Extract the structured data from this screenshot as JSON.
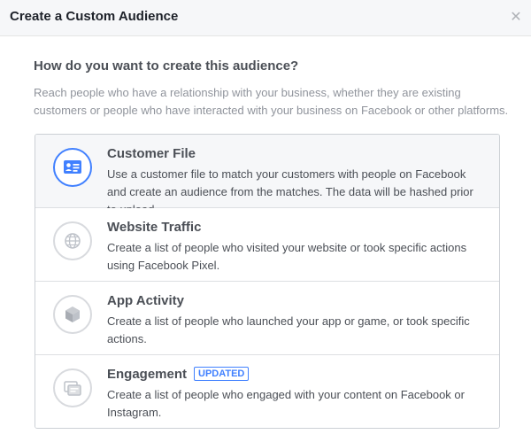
{
  "dialog": {
    "title": "Create a Custom Audience",
    "close_icon": "close-icon"
  },
  "question": "How do you want to create this audience?",
  "intro": "Reach people who have a relationship with your business, whether they are existing customers or people who have interacted with your business on Facebook or other platforms.",
  "options": [
    {
      "title": "Customer File",
      "description": "Use a customer file to match your customers with people on Facebook and create an audience from the matches. The data will be hashed prior to upload.",
      "icon": "contact-card-icon",
      "selected": true
    },
    {
      "title": "Website Traffic",
      "description": "Create a list of people who visited your website or took specific actions using Facebook Pixel.",
      "icon": "globe-icon",
      "selected": false
    },
    {
      "title": "App Activity",
      "description": "Create a list of people who launched your app or game, or took specific actions.",
      "icon": "cube-icon",
      "selected": false
    },
    {
      "title": "Engagement",
      "badge": "UPDATED",
      "description": "Create a list of people who engaged with your content on Facebook or Instagram.",
      "icon": "stacked-cards-icon",
      "selected": false
    }
  ],
  "colors": {
    "accent": "#4080ff",
    "header_bg": "#f6f7f9",
    "selected_bg": "#f6f7f9",
    "muted_text": "#90949c",
    "body_text": "#4b4f56"
  }
}
